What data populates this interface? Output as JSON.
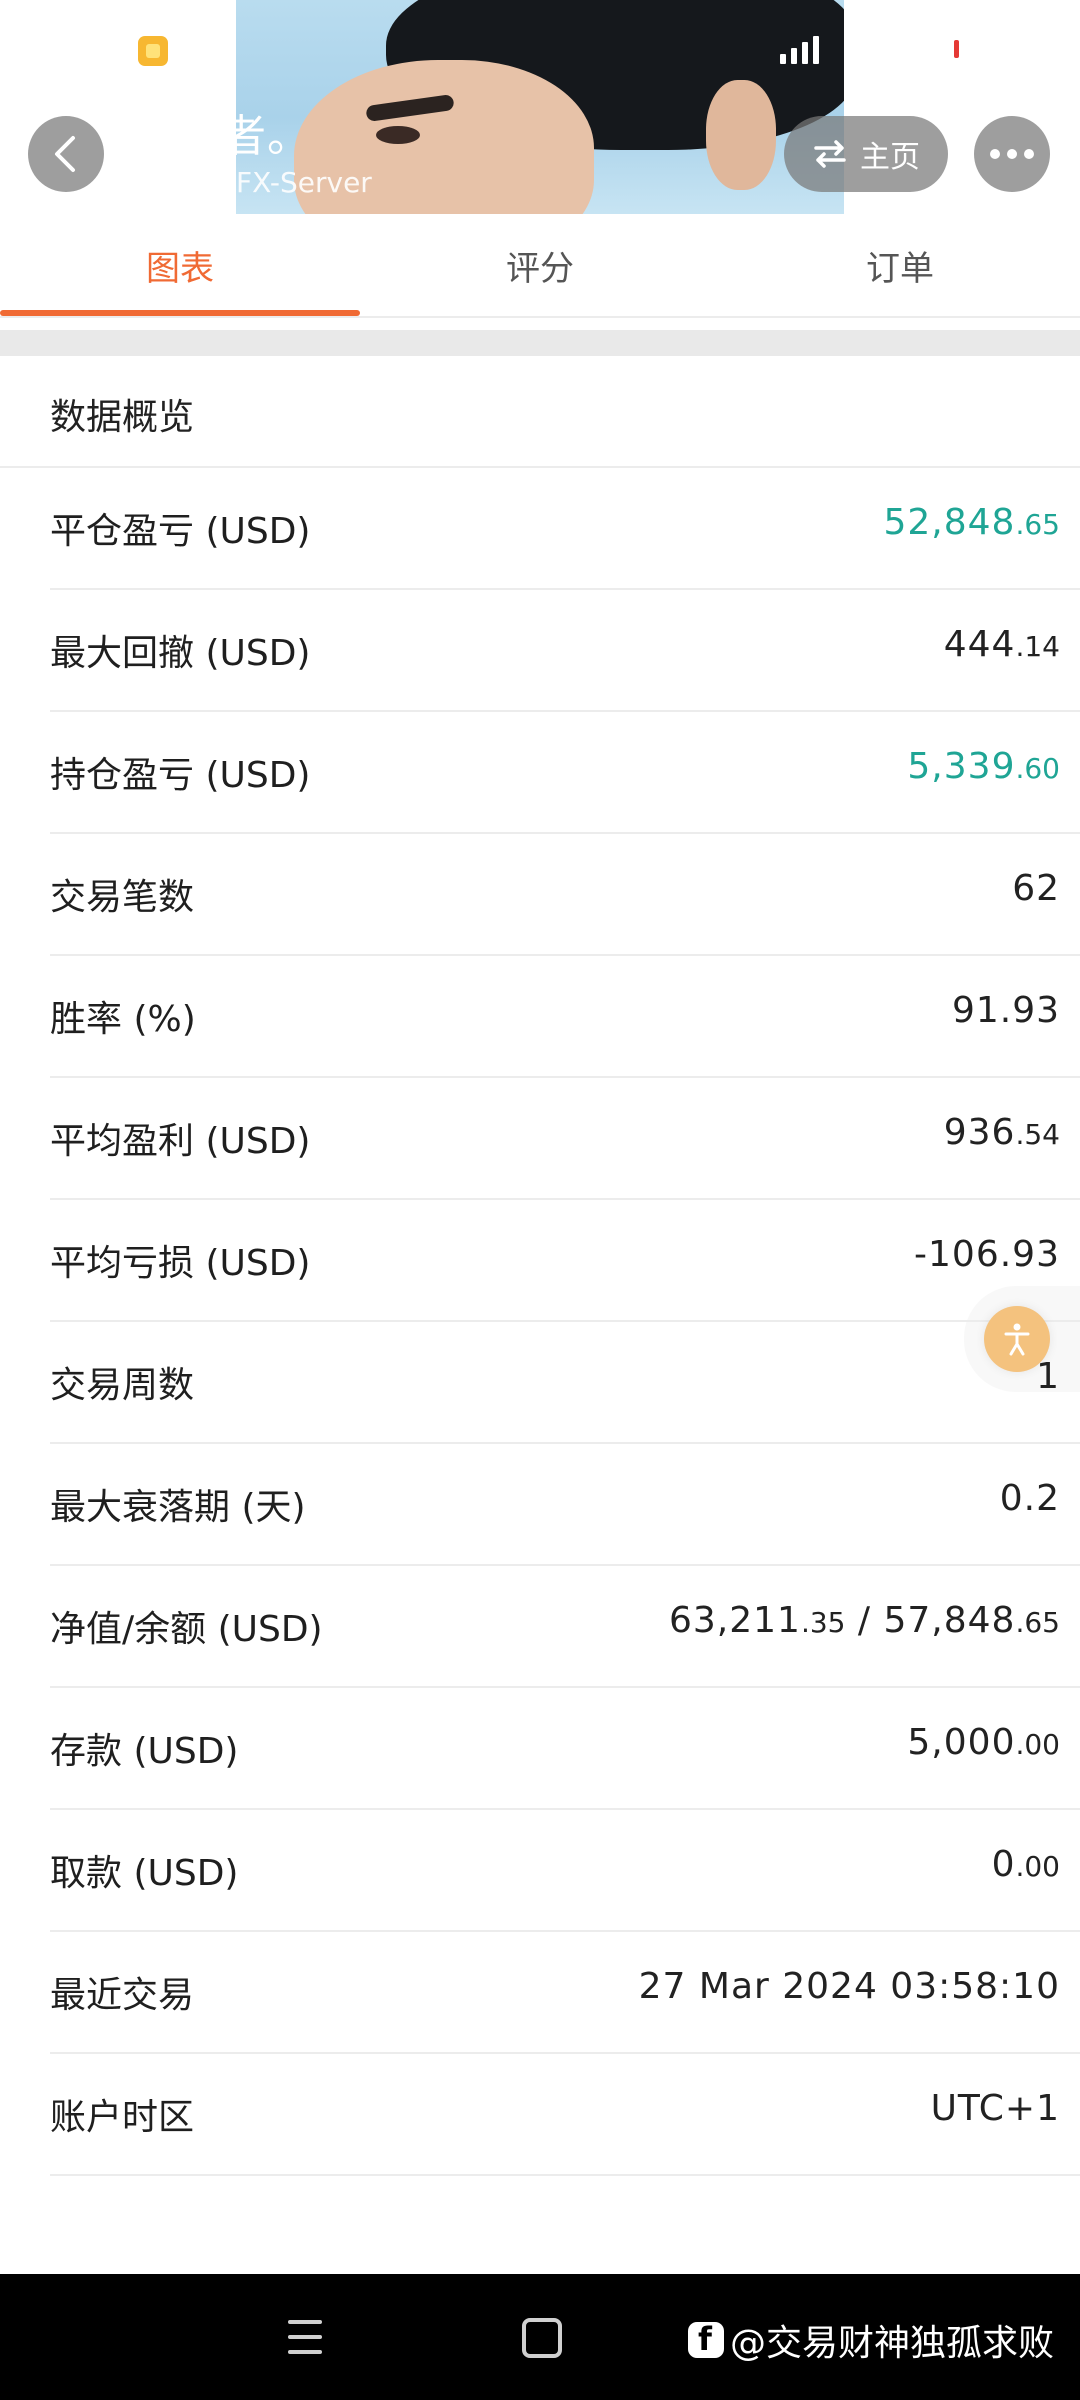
{
  "header": {
    "title": "交易者。",
    "subtitle": "FX-Server",
    "home_label": "主页"
  },
  "tabs": [
    {
      "label": "图表",
      "active": true
    },
    {
      "label": "评分",
      "active": false
    },
    {
      "label": "订单",
      "active": false
    }
  ],
  "section": {
    "title": "数据概览"
  },
  "rows": [
    {
      "label": "平仓盈亏 (USD)",
      "value_main": "52,848",
      "value_dec": ".65",
      "color": "#1fa595"
    },
    {
      "label": "最大回撤 (USD)",
      "value_main": "444",
      "value_dec": ".14"
    },
    {
      "label": "持仓盈亏 (USD)",
      "value_main": "5,339",
      "value_dec": ".60",
      "color": "#1fa595"
    },
    {
      "label": "交易笔数",
      "value_main": "62",
      "value_dec": ""
    },
    {
      "label": "胜率 (%)",
      "value_main": "91.93",
      "value_dec": ""
    },
    {
      "label": "平均盈利 (USD)",
      "value_main": "936",
      "value_dec": ".54"
    },
    {
      "label": "平均亏损 (USD)",
      "value_main": "-106.93",
      "value_dec": ""
    },
    {
      "label": "交易周数",
      "value_main": "1",
      "value_dec": ""
    },
    {
      "label": "最大衰落期 (天)",
      "value_main": "0.2",
      "value_dec": ""
    },
    {
      "label": "净值/余额 (USD)",
      "value_main": "63,211",
      "value_dec": ".35",
      "value_main2": " / 57,848",
      "value_dec2": ".65"
    },
    {
      "label": "存款 (USD)",
      "value_main": "5,000",
      "value_dec": ".00"
    },
    {
      "label": "取款 (USD)",
      "value_main": "0",
      "value_dec": ".00"
    },
    {
      "label": "最近交易",
      "value_main": "27 Mar 2024 03:58:10",
      "value_dec": ""
    },
    {
      "label": "账户时区",
      "value_main": "UTC+1",
      "value_dec": ""
    }
  ],
  "watermark": {
    "text": "@交易财神独孤求败"
  },
  "icons": {
    "back": "chevron-left-icon",
    "home": "swap-arrows-icon",
    "more": "more-dots-icon",
    "floating": "accessibility-icon"
  },
  "colors": {
    "accent": "#f06a34",
    "positive": "#1fa595"
  }
}
